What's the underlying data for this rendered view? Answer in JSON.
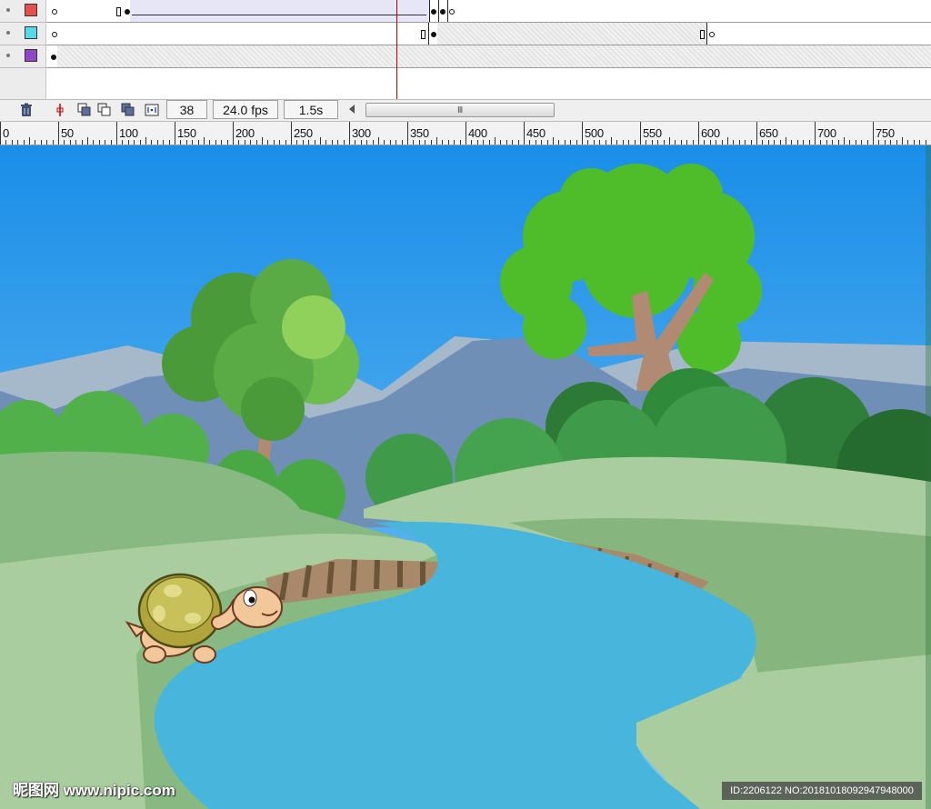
{
  "timeline": {
    "layers": [
      {
        "name": "layer-red",
        "color": "#e2514e"
      },
      {
        "name": "layer-cyan",
        "color": "#58d9e8"
      },
      {
        "name": "layer-purple",
        "color": "#9245c5"
      }
    ],
    "current_frame": "38",
    "frame_rate": "24.0 fps",
    "elapsed_time": "1.5s",
    "scroll_grip": "III"
  },
  "ruler": {
    "labels": [
      "0",
      "50",
      "100",
      "150",
      "200",
      "250",
      "300",
      "350",
      "400",
      "450",
      "500",
      "550",
      "600",
      "650",
      "700",
      "750"
    ]
  },
  "watermark": {
    "text": "昵图网 www.nipic.com",
    "id_text": "ID:2206122 NO:20181018092947948000"
  },
  "colors": {
    "sky_top": "#1a8ee8",
    "sky_bottom": "#7fc6f5",
    "mountain": "#8aa3b8",
    "river": "#47b5dc",
    "grass_light": "#a9cd9e",
    "grass_dark": "#86b67e",
    "tree_green": "#4fbd2a",
    "playhead": "#c40000"
  }
}
